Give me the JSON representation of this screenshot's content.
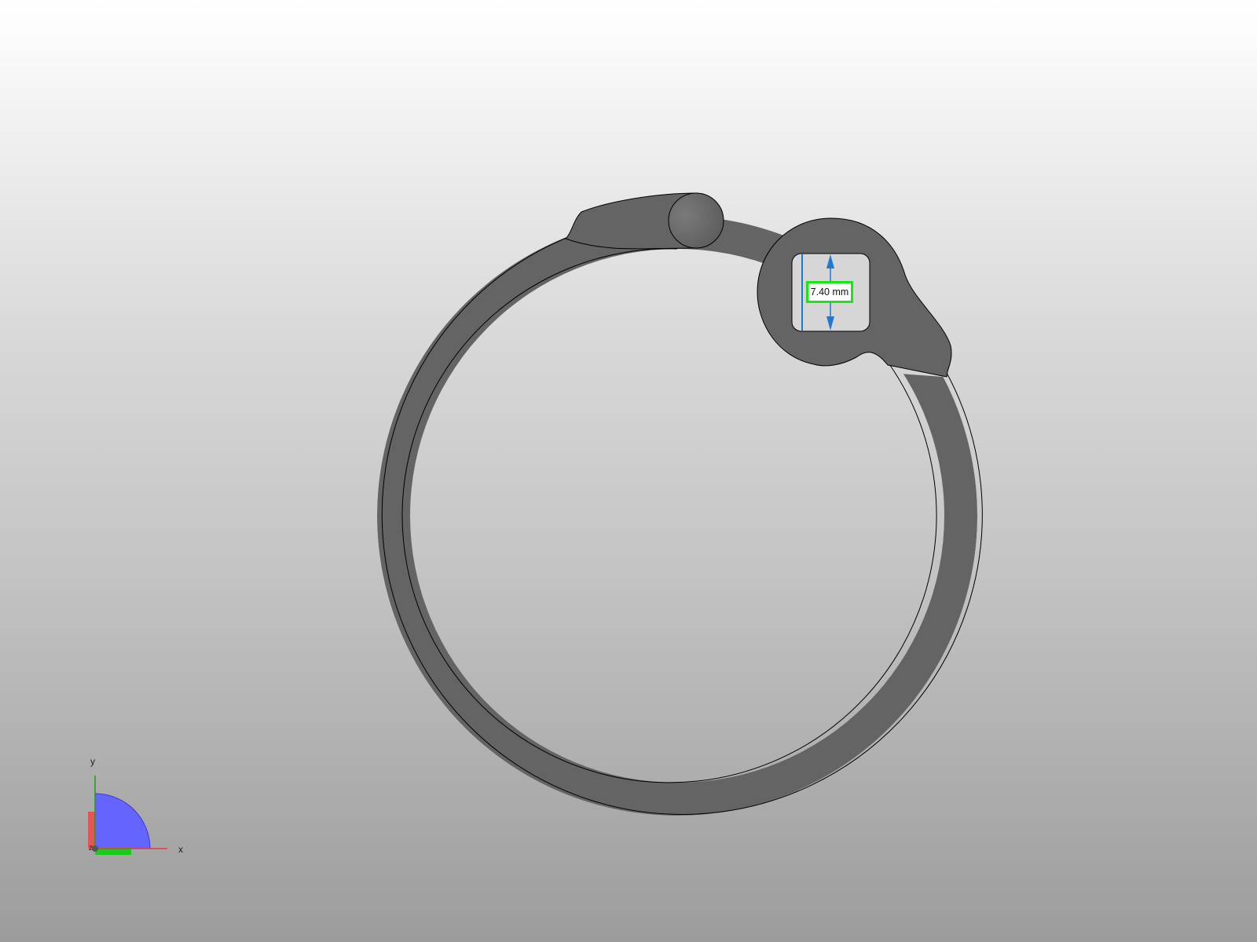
{
  "viewport": {
    "background_top": "#ffffff",
    "background_bottom": "#9c9c9c"
  },
  "model": {
    "part": "open-ring-clip",
    "fill_color": "#646464",
    "edge_color": "#000000"
  },
  "measurement": {
    "value_label": "7.40 mm",
    "line_color": "#1f78d1",
    "label_border_color": "#19e619"
  },
  "axis_triad": {
    "x_label": "x",
    "y_label": "y",
    "z_label": "z",
    "x_color": "#e33b3b",
    "y_color": "#1ec91e",
    "z_color": "#6464ff"
  }
}
